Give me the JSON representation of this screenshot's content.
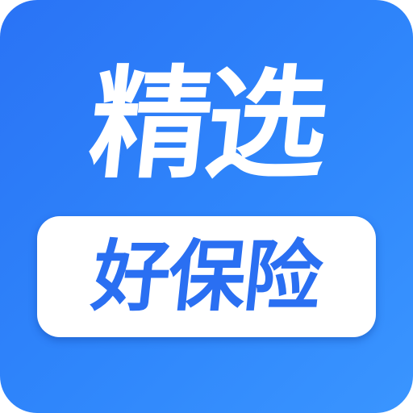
{
  "icon": {
    "title": "精选",
    "subtitle": "好保险",
    "colors": {
      "background": "#2f86fb",
      "title_text": "#ffffff",
      "pill_background": "#ffffff",
      "subtitle_text": "#2a6ff2"
    }
  }
}
